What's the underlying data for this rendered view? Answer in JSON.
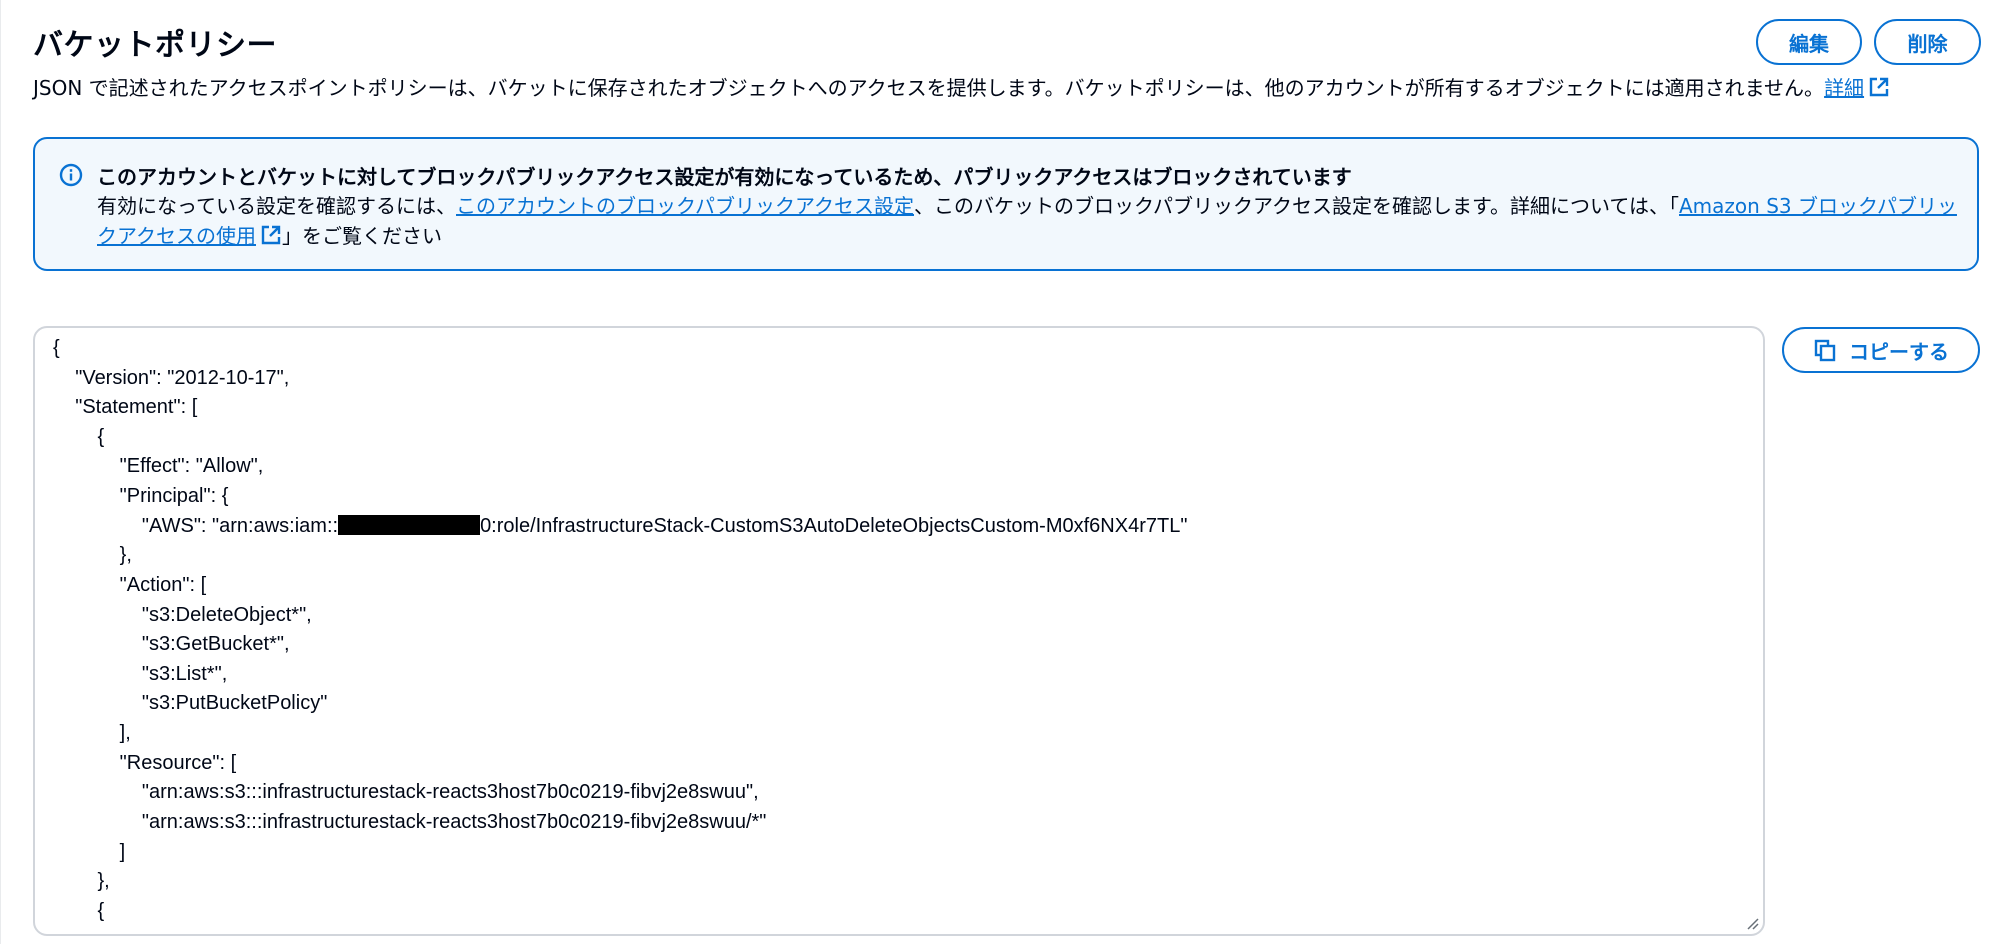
{
  "header": {
    "title": "バケットポリシー",
    "description": "JSON で記述されたアクセスポイントポリシーは、バケットに保存されたオブジェクトへのアクセスを提供します。バケットポリシーは、他のアカウントが所有するオブジェクトには適用されません。",
    "details_link": "詳細",
    "edit_label": "編集",
    "delete_label": "削除"
  },
  "alert": {
    "title": "このアカウントとバケットに対してブロックパブリックアクセス設定が有効になっているため、パブリックアクセスはブロックされています",
    "body_prefix": "有効になっている設定を確認するには、",
    "account_link": "このアカウントのブロックパブリックアクセス設定",
    "body_middle": "、このバケットのブロックパブリックアクセス設定を確認します。詳細については、「",
    "docs_link": "Amazon S3 ブロックパブリックアクセスの使用",
    "body_suffix": "」をご覧ください"
  },
  "editor": {
    "copy_label": "コピーする",
    "lines": [
      "{",
      "    \"Version\": \"2012-10-17\",",
      "    \"Statement\": [",
      "        {",
      "            \"Effect\": \"Allow\",",
      "            \"Principal\": {",
      "                \"AWS\": \"arn:aws:iam::",
      "            },",
      "            \"Action\": [",
      "                \"s3:DeleteObject*\",",
      "                \"s3:GetBucket*\",",
      "                \"s3:List*\",",
      "                \"s3:PutBucketPolicy\"",
      "            ],",
      "            \"Resource\": [",
      "                \"arn:aws:s3:::infrastructurestack-reacts3host7b0c0219-fibvj2e8swuu\",",
      "                \"arn:aws:s3:::infrastructurestack-reacts3host7b0c0219-fibvj2e8swuu/*\"",
      "            ]",
      "        },",
      "        {"
    ],
    "principal_suffix": "0:role/InfrastructureStack-CustomS3AutoDeleteObjectsCustom-M0xf6NX4r7TL\""
  },
  "colors": {
    "accent": "#0972d3",
    "alert_bg": "#f2f8fd",
    "text": "#000716"
  },
  "icons": {
    "info": "info-circle-icon",
    "external": "external-link-icon",
    "copy": "copy-icon",
    "resize": "resize-handle-icon"
  }
}
